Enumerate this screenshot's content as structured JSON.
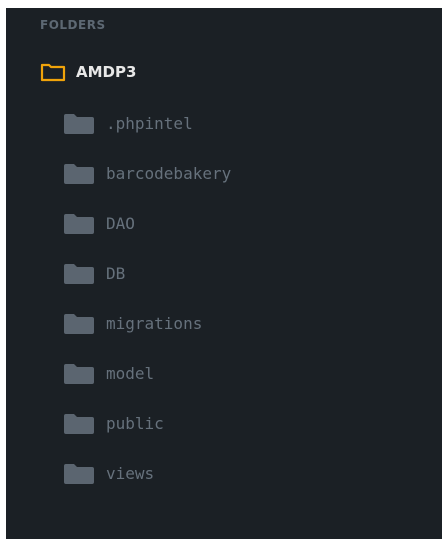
{
  "sidebar": {
    "section_title": "FOLDERS",
    "root": {
      "label": "AMDP3",
      "icon": "folder-open-icon",
      "icon_color": "#f0a30a"
    },
    "folders": [
      {
        "label": ".phpintel",
        "icon": "folder-icon"
      },
      {
        "label": "barcodebakery",
        "icon": "folder-icon"
      },
      {
        "label": "DAO",
        "icon": "folder-icon"
      },
      {
        "label": "DB",
        "icon": "folder-icon"
      },
      {
        "label": "migrations",
        "icon": "folder-icon"
      },
      {
        "label": "model",
        "icon": "folder-icon"
      },
      {
        "label": "public",
        "icon": "folder-icon"
      },
      {
        "label": "views",
        "icon": "folder-icon"
      }
    ],
    "colors": {
      "background": "#1b2025",
      "folder_icon": "#5b6570",
      "folder_text": "#66717c",
      "root_text": "#e8e8e8"
    }
  }
}
